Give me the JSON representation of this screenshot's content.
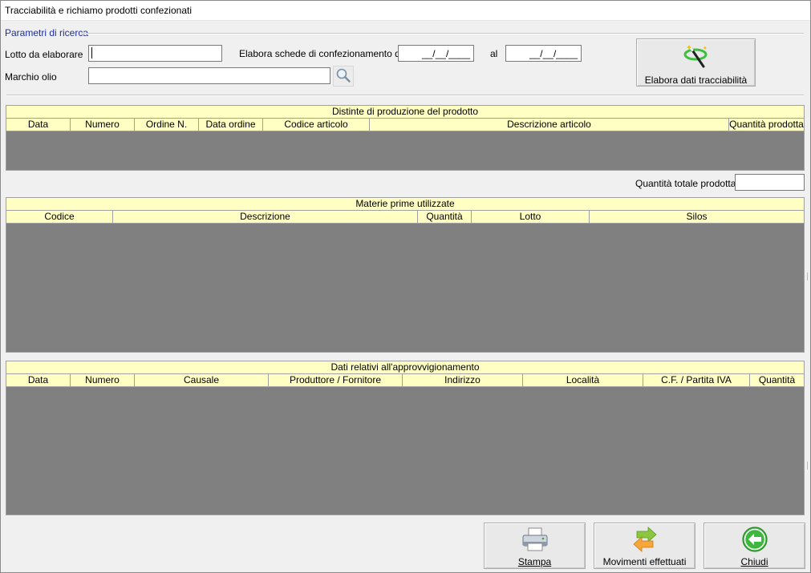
{
  "window": {
    "title": "Tracciabilità e richiamo prodotti confezionati"
  },
  "search": {
    "group_title": "Parametri di ricerca",
    "lotto_label": "Lotto da elaborare",
    "lotto_value": "",
    "marchio_label": "Marchio olio",
    "marchio_value": "",
    "schede_label": "Elabora schede di confezionamento dal",
    "date_from": "__/__/____",
    "al_label": "al",
    "date_to": "__/__/____",
    "search_icon": "magnifier-icon",
    "elabora_button_label": "Elabora dati tracciabilità",
    "elabora_icon": "magic-wand-icon"
  },
  "distinte": {
    "caption": "Distinte di produzione del prodotto",
    "columns": [
      "Data",
      "Numero",
      "Ordine N.",
      "Data ordine",
      "Codice articolo",
      "Descrizione articolo",
      "Quantità prodotta"
    ],
    "rows": []
  },
  "totale": {
    "label": "Quantità totale prodotta",
    "value": ""
  },
  "materie": {
    "caption": "Materie prime utilizzate",
    "columns": [
      "Codice",
      "Descrizione",
      "Quantità",
      "Lotto",
      "Silos"
    ],
    "rows": []
  },
  "approvvigionamento": {
    "caption": "Dati relativi all'approvvigionamento",
    "columns": [
      "Data",
      "Numero",
      "Causale",
      "Produttore / Fornitore",
      "Indirizzo",
      "Località",
      "C.F. / Partita IVA",
      "Quantità"
    ],
    "rows": []
  },
  "footer": {
    "stampa_label": "Stampa",
    "stampa_icon": "printer-icon",
    "movimenti_label": "Movimenti effettuati",
    "movimenti_icon": "swap-arrows-icon",
    "chiudi_label": "Chiudi",
    "chiudi_icon": "back-arrow-icon"
  },
  "colors": {
    "grid_header": "#ffffc4",
    "grid_body": "#808080",
    "group_title": "#1c2ea0"
  }
}
